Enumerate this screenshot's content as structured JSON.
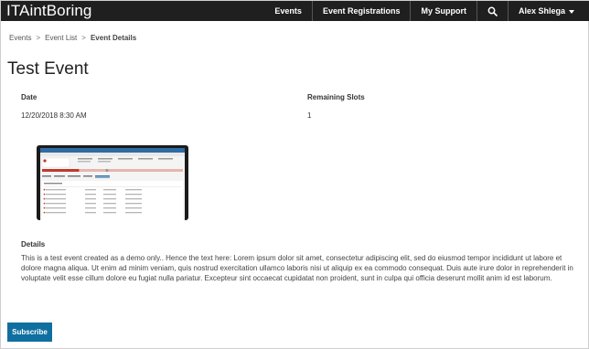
{
  "brand": "ITAintBoring",
  "nav": {
    "items": [
      "Events",
      "Event Registrations",
      "My Support"
    ],
    "user": "Alex Shlega"
  },
  "breadcrumb": {
    "items": [
      "Events",
      "Event List"
    ],
    "current": "Event Details",
    "separator": ">"
  },
  "page_title": "Test Event",
  "fields": {
    "date_label": "Date",
    "date_value": "12/20/2018 8:30 AM",
    "slots_label": "Remaining Slots",
    "slots_value": "1"
  },
  "details": {
    "label": "Details",
    "text": "This is a test event created as a demo only.. Hence the text here: Lorem ipsum dolor sit amet, consectetur adipiscing elit, sed do eiusmod tempor incididunt ut labore et dolore magna aliqua. Ut enim ad minim veniam, quis nostrud exercitation ullamco laboris nisi ut aliquip ex ea commodo consequat. Duis aute irure dolor in reprehenderit in voluptate velit esse cillum dolore eu fugiat nulla pariatur. Excepteur sint occaecat cupidatat non proident, sunt in culpa qui officia deserunt mollit anim id est laborum."
  },
  "subscribe_label": "Subscribe",
  "colors": {
    "navbar": "#1f1f1f",
    "accent": "#0f6fa0"
  },
  "icons": {
    "search": "search-icon",
    "user_menu": "caret-down-icon"
  }
}
